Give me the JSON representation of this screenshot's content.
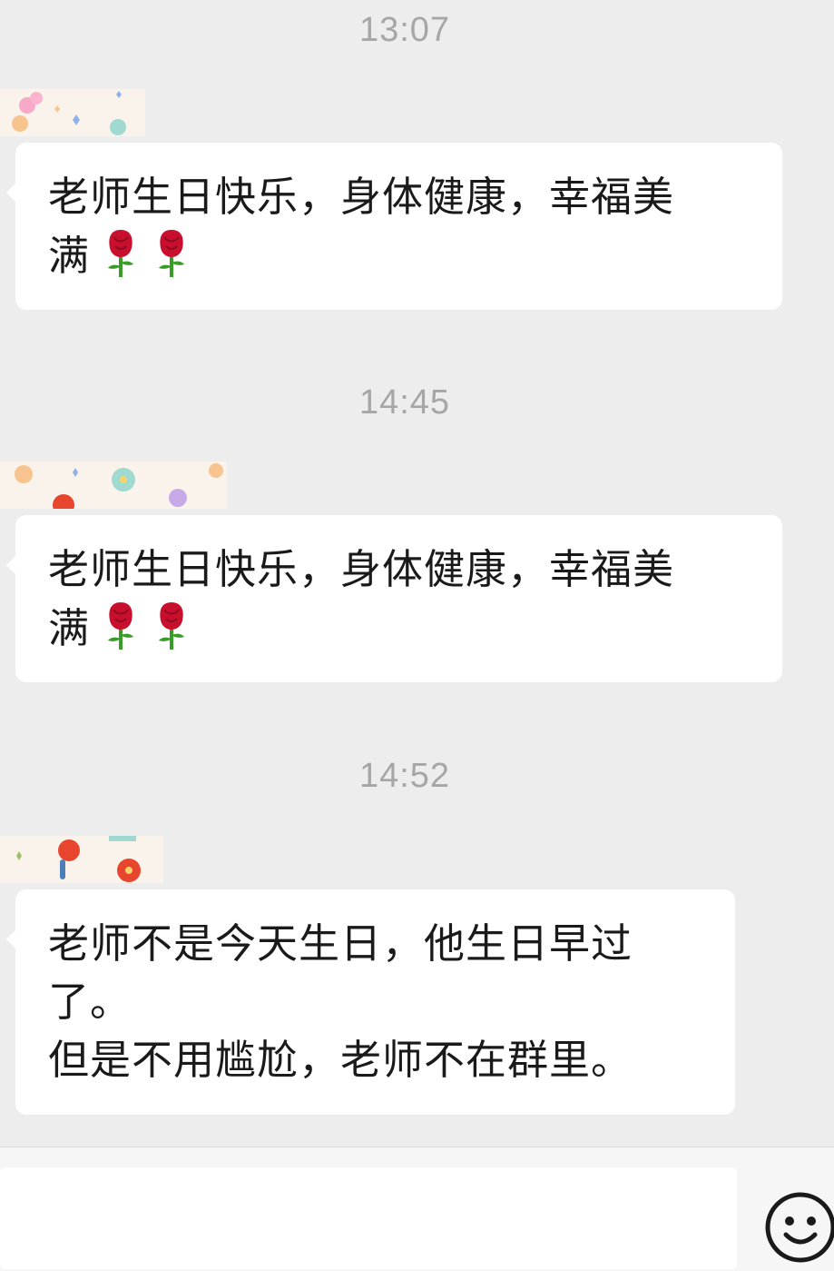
{
  "chat": {
    "messages": [
      {
        "time": "13:07",
        "text": "老师生日快乐，身体健康，幸福美\n满",
        "roses": 2
      },
      {
        "time": "14:45",
        "text": "老师生日快乐，身体健康，幸福美\n满",
        "roses": 2
      },
      {
        "time": "14:52",
        "text": "老师不是今天生日，他生日早过\n了。\n但是不用尴尬，老师不在群里。",
        "roses": 0
      }
    ]
  },
  "input_bar": {
    "value": "",
    "emoji_icon": "smiley-face-icon"
  },
  "colors": {
    "background": "#ededed",
    "bubble": "#ffffff",
    "timestamp": "#a6a6a6",
    "rose_red": "#c8102e",
    "stem_green": "#3a9a2a"
  }
}
